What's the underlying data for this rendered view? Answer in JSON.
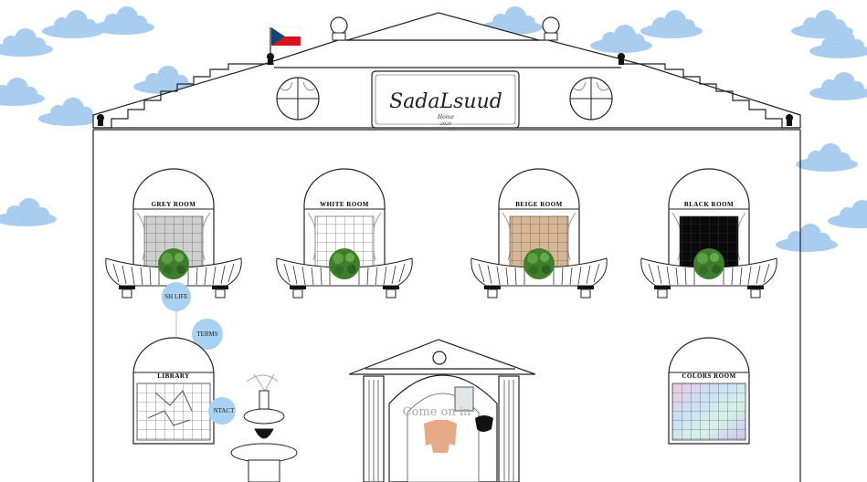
{
  "logo": {
    "name": "SadaLsuud",
    "line1": "Home",
    "line2": "2020"
  },
  "rooms": [
    {
      "label": "GREY ROOM",
      "fill": "#cfcfcf"
    },
    {
      "label": "WHITE ROOM",
      "fill": "#ffffff"
    },
    {
      "label": "BEIGE ROOM",
      "fill": "#d8b693"
    },
    {
      "label": "BLACK ROOM",
      "fill": "#0a0a0a"
    }
  ],
  "lower_rooms": {
    "library": {
      "label": "LIBRARY"
    },
    "colors": {
      "label": "COLORS ROOM"
    }
  },
  "nav": {
    "sh_life": "SH LIFE",
    "terms": "TERMS",
    "contact": "NTACT"
  },
  "door_sign": "Come on in",
  "colors": {
    "sky_cloud": "#a9cdef",
    "nav_circle": "#a8d2f2",
    "shrub": "#3f7f2c",
    "flag_blue": "#11457e",
    "flag_red": "#d7141a",
    "sweater": "#e8a987"
  },
  "icons": [
    "flag-icon",
    "cloud-icon",
    "shrub-icon",
    "fountain-icon"
  ]
}
